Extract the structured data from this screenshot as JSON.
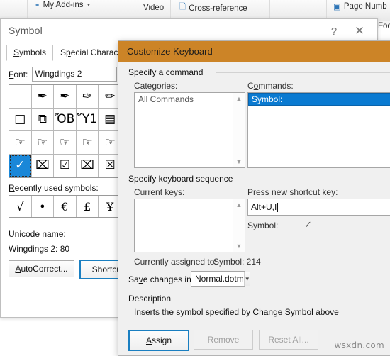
{
  "ribbon": {
    "items": [
      {
        "label": "My Add-ins",
        "icon": "addins-icon",
        "has_dropdown": true
      },
      {
        "label": "Video",
        "icon": "",
        "has_dropdown": false
      },
      {
        "label": "Cross-reference",
        "icon": "cross-reference-icon",
        "has_dropdown": false
      },
      {
        "label": "Page Numb",
        "icon": "page-number-icon",
        "has_dropdown": false
      }
    ],
    "footnote_label": "Foo"
  },
  "symbol_dialog": {
    "title": "Symbol",
    "help_glyph": "?",
    "close_glyph": "✕",
    "tabs": [
      {
        "label": "Symbols",
        "accesskey": "S",
        "selected": true
      },
      {
        "label": "Special Characters",
        "accesskey": "p",
        "selected": false
      }
    ],
    "font_label": "Font:",
    "font_value": "Wingdings 2",
    "symbol_grid": [
      {
        "glyph": "",
        "selected": false
      },
      {
        "glyph": "✒",
        "selected": false
      },
      {
        "glyph": "✒",
        "selected": false
      },
      {
        "glyph": "✑",
        "selected": false
      },
      {
        "glyph": "✏",
        "selected": false
      },
      {
        "glyph": "□",
        "selected": false
      },
      {
        "glyph": "⧉",
        "selected": false
      },
      {
        "glyph": "ὌB",
        "selected": false
      },
      {
        "glyph": "Ὕ1",
        "selected": false
      },
      {
        "glyph": "▤",
        "selected": false
      },
      {
        "glyph": "☞",
        "selected": false
      },
      {
        "glyph": "☞",
        "selected": false
      },
      {
        "glyph": "☞",
        "selected": false
      },
      {
        "glyph": "☞",
        "selected": false
      },
      {
        "glyph": "☞",
        "selected": false
      },
      {
        "glyph": "✓",
        "selected": true
      },
      {
        "glyph": "⌧",
        "selected": false
      },
      {
        "glyph": "☑",
        "selected": false
      },
      {
        "glyph": "⌧",
        "selected": false
      },
      {
        "glyph": "☒",
        "selected": false
      }
    ],
    "recent_label": "Recently used symbols:",
    "recent_accesskey": "R",
    "recent_symbols": [
      "√",
      "•",
      "€",
      "£",
      "¥"
    ],
    "unicode_name_label": "Unicode name:",
    "unicode_name_value": "Wingdings 2: 80",
    "autocorrect_button": "AutoCorrect...",
    "autocorrect_accesskey": "A",
    "shortcut_button": "Shortcut"
  },
  "customize_keyboard": {
    "title": "Customize Keyboard",
    "specify_command_group": "Specify a command",
    "categories_label": "Categories:",
    "categories": [
      "All Commands"
    ],
    "commands_label": "Commands:",
    "commands_accesskey": "o",
    "commands": [
      {
        "label": "Symbol:",
        "selected": true
      }
    ],
    "keyboard_sequence_group": "Specify keyboard sequence",
    "current_keys_label": "Current keys:",
    "current_keys_accesskey": "u",
    "current_keys": [],
    "new_shortcut_label": "Press new shortcut key:",
    "new_shortcut_accesskey": "n",
    "new_shortcut_value": "Alt+U,I",
    "symbol_row_label": "Symbol:",
    "symbol_row_glyph": "✓",
    "currently_assigned_label": "Currently assigned to:",
    "currently_assigned_value": "Symbol: 214",
    "save_changes_label": "Save changes in:",
    "save_changes_accesskey": "v",
    "save_changes_value": "Normal.dotm",
    "description_group": "Description",
    "description_text": "Inserts the symbol specified by Change Symbol above",
    "buttons": [
      {
        "label": "Assign",
        "accesskey": "A",
        "state": "primary"
      },
      {
        "label": "Remove",
        "accesskey": "",
        "state": "disabled"
      },
      {
        "label": "Reset All...",
        "accesskey": "",
        "state": "disabled"
      }
    ]
  },
  "watermark": "wsxdn.com",
  "colors": {
    "dialog_title_orange": "#cc8427",
    "selection_blue": "#0a7ad1",
    "symbol_selection_blue": "#1a87d8",
    "focus_border_blue": "#1a7fc1"
  }
}
